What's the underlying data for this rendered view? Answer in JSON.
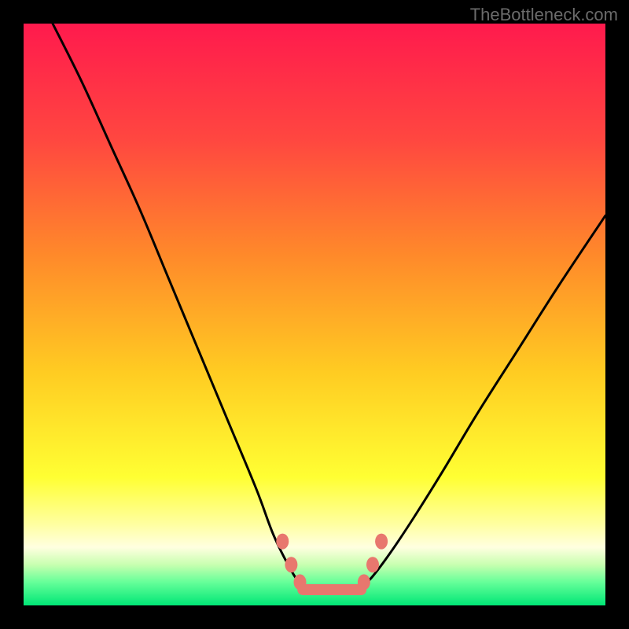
{
  "watermark": "TheBottleneck.com",
  "chart_data": {
    "type": "line",
    "title": "",
    "xlabel": "",
    "ylabel": "",
    "xlim": [
      0,
      100
    ],
    "ylim": [
      0,
      100
    ],
    "gradient_stops": [
      {
        "offset": 0,
        "color": "#ff1a4d"
      },
      {
        "offset": 20,
        "color": "#ff4740"
      },
      {
        "offset": 40,
        "color": "#ff8a2a"
      },
      {
        "offset": 60,
        "color": "#ffcc22"
      },
      {
        "offset": 78,
        "color": "#ffff33"
      },
      {
        "offset": 86,
        "color": "#ffffa0"
      },
      {
        "offset": 90,
        "color": "#ffffe0"
      },
      {
        "offset": 93,
        "color": "#c8ffb0"
      },
      {
        "offset": 96,
        "color": "#66ff99"
      },
      {
        "offset": 100,
        "color": "#00e676"
      }
    ],
    "series": [
      {
        "name": "left-curve",
        "x": [
          5,
          10,
          15,
          20,
          25,
          30,
          35,
          40,
          43,
          46,
          48
        ],
        "y": [
          100,
          90,
          79,
          68,
          56,
          44,
          32,
          20,
          12,
          6,
          3
        ]
      },
      {
        "name": "right-curve",
        "x": [
          58,
          60,
          63,
          67,
          72,
          78,
          85,
          92,
          100
        ],
        "y": [
          3,
          5,
          9,
          15,
          23,
          33,
          44,
          55,
          67
        ]
      },
      {
        "name": "valley-floor",
        "x": [
          48,
          50,
          52,
          54,
          56,
          58
        ],
        "y": [
          3,
          2.5,
          2.5,
          2.5,
          2.5,
          3
        ]
      }
    ],
    "markers": {
      "left_cluster": [
        {
          "x": 44.5,
          "y": 11
        },
        {
          "x": 46,
          "y": 7
        },
        {
          "x": 47.5,
          "y": 4
        }
      ],
      "right_cluster": [
        {
          "x": 58.5,
          "y": 4
        },
        {
          "x": 60,
          "y": 7
        },
        {
          "x": 61.5,
          "y": 11
        }
      ],
      "floor_pill": {
        "x0": 48,
        "x1": 58,
        "y": 2.7
      }
    }
  }
}
